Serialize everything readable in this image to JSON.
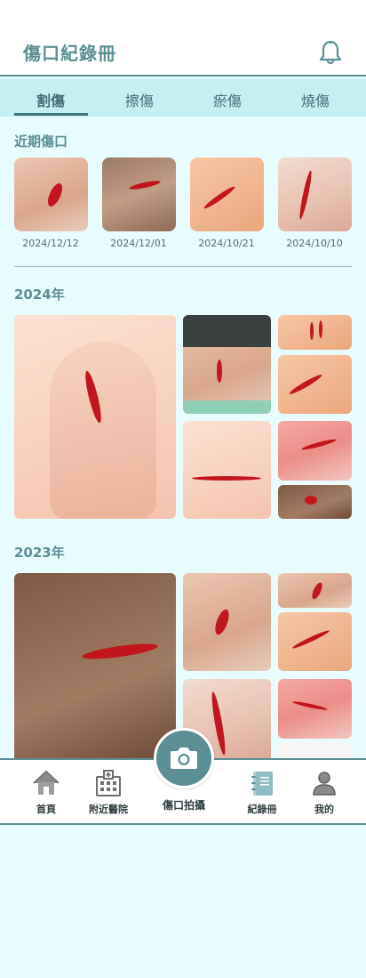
{
  "header": {
    "title": "傷口紀錄冊",
    "notification_icon": "bell-icon"
  },
  "tabs": [
    {
      "label": "割傷",
      "active": true
    },
    {
      "label": "擦傷",
      "active": false
    },
    {
      "label": "瘀傷",
      "active": false
    },
    {
      "label": "燒傷",
      "active": false
    }
  ],
  "recent": {
    "title": "近期傷口",
    "items": [
      {
        "date": "2024/12/12"
      },
      {
        "date": "2024/12/01"
      },
      {
        "date": "2024/10/21"
      },
      {
        "date": "2024/10/10"
      }
    ]
  },
  "year_2024": {
    "title": "2024年"
  },
  "year_2023": {
    "title": "2023年"
  },
  "bottom_nav": {
    "home": "首頁",
    "nearby_hospital": "附近醫院",
    "camera": "傷口拍攝",
    "records": "紀錄冊",
    "profile": "我的"
  },
  "colors": {
    "primary": "#5b8f93",
    "background": "#e9fcfd",
    "tab_bar": "#c6eff1",
    "wound_red": "#c1161d"
  }
}
